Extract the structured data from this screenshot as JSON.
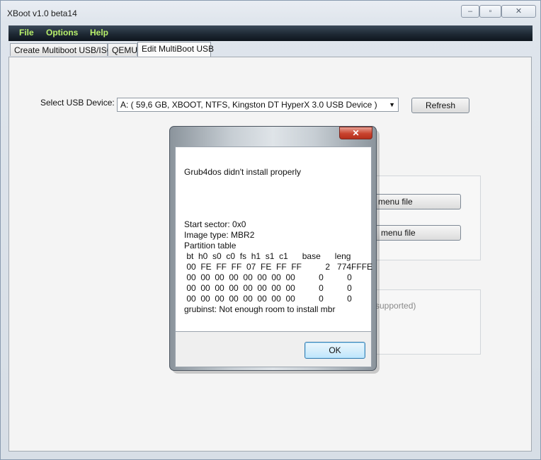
{
  "window": {
    "title": "XBoot v1.0 beta14"
  },
  "menu": [
    "File",
    "Options",
    "Help"
  ],
  "tabs": [
    "Create Multiboot USB/ISO",
    "QEMU",
    "Edit MultiBoot USB"
  ],
  "device": {
    "label": "Select USB Device:",
    "selected": "A:  ( 59,6 GB,   XBOOT,   NTFS,   Kingston DT HyperX 3.0 USB Device )",
    "refresh": "Refresh"
  },
  "background": {
    "button1_partial": "menu file",
    "button2_partial": "menu file",
    "note_partial": "supported)"
  },
  "dialog": {
    "heading": "Grub4dos didn't install properly",
    "lines": [
      "Start sector: 0x0",
      "Image type: MBR2",
      "Partition table",
      " bt  h0  s0  c0  fs  h1  s1  c1      base      leng",
      " 00  FE  FF  FF  07  FE  FF  FF          2   774FFFE",
      " 00  00  00  00  00  00  00  00          0          0",
      " 00  00  00  00  00  00  00  00          0          0",
      " 00  00  00  00  00  00  00  00          0          0",
      "grubinst: Not enough room to install mbr"
    ],
    "ok_label": "OK",
    "close_glyph": "✕"
  }
}
